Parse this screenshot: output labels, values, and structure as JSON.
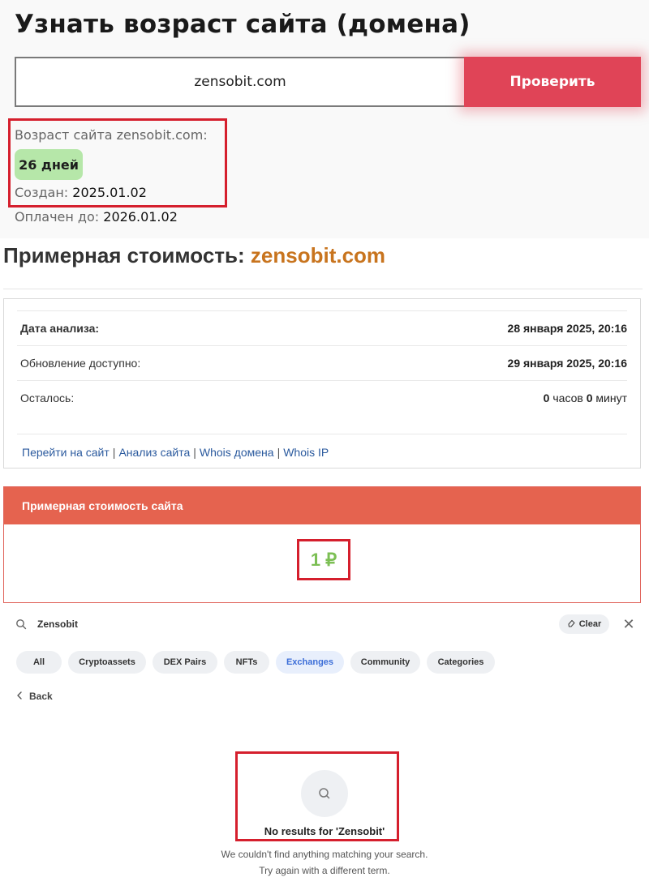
{
  "age_checker": {
    "title": "Узнать возраст сайта (домена)",
    "input_value": "zensobit.com",
    "check_button": "Проверить",
    "age_label": "Возраст сайта zensobit.com:",
    "age_badge": "26 дней",
    "created_label": "Создан:",
    "created_value": "2025.01.02",
    "paid_label": "Оплачен до:",
    "paid_value": "2026.01.02"
  },
  "valuation": {
    "title_prefix": "Примерная стоимость:",
    "title_domain": "zensobit.com",
    "rows": [
      {
        "label": "Дата анализа:",
        "value": "28 января 2025, 20:16"
      },
      {
        "label": "Обновление доступно:",
        "value": "29 января 2025, 20:16"
      }
    ],
    "remaining": {
      "label": "Осталось:",
      "hours_num": "0",
      "hours_word": "часов",
      "minutes_num": "0",
      "minutes_word": "минут"
    },
    "links": [
      "Перейти на сайт",
      "Анализ сайта",
      "Whois домена",
      "Whois IP"
    ],
    "link_separator": "|",
    "card_header": "Примерная стоимость сайта",
    "card_value": "1 ₽"
  },
  "search": {
    "query": "Zensobit",
    "clear_label": "Clear",
    "close_symbol": "✕",
    "filters": [
      "All",
      "Cryptoassets",
      "DEX Pairs",
      "NFTs",
      "Exchanges",
      "Community",
      "Categories"
    ],
    "active_filter": "Exchanges",
    "back_label": "Back",
    "empty_title": "No results for 'Zensobit'",
    "empty_line1": "We couldn't find anything matching your search.",
    "empty_line2": "Try again with a different term."
  },
  "colors": {
    "button_red": "#e04457",
    "badge_green": "#b6e7a9",
    "highlight_red": "#d51f2d",
    "domain_orange": "#c8741e",
    "card_header": "#e5634f",
    "value_green": "#7cbf54",
    "link_blue": "#2b5a9e",
    "active_chip_blue": "#3c6ed8"
  },
  "icons": [
    "search-icon",
    "eraser-icon",
    "close-icon",
    "chevron-left-icon",
    "empty-search-icon"
  ]
}
